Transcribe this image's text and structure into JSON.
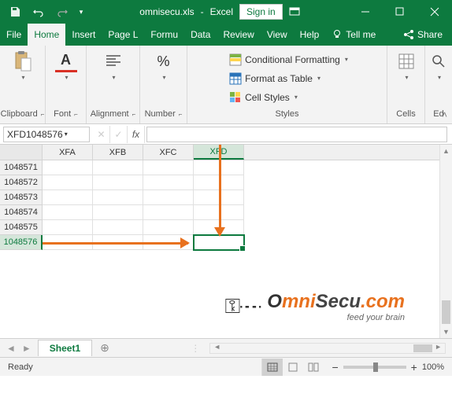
{
  "titlebar": {
    "filename": "omnisecu.xls",
    "app": "Excel",
    "signin": "Sign in"
  },
  "menu": {
    "file": "File",
    "home": "Home",
    "insert": "Insert",
    "pagelayout": "Page L",
    "formulas": "Formu",
    "data": "Data",
    "review": "Review",
    "view": "View",
    "help": "Help",
    "tellme": "Tell me",
    "share": "Share"
  },
  "ribbon": {
    "clipboard": "Clipboard",
    "font": "Font",
    "alignment": "Alignment",
    "number": "Number",
    "styles": "Styles",
    "cells": "Cells",
    "editing": "Ed",
    "cond_fmt": "Conditional Formatting",
    "fmt_table": "Format as Table",
    "cell_styles": "Cell Styles"
  },
  "formula": {
    "name_box": "XFD1048576",
    "fx": "fx"
  },
  "grid": {
    "cols": [
      "XFA",
      "XFB",
      "XFC",
      "XFD"
    ],
    "rows": [
      "1048571",
      "1048572",
      "1048573",
      "1048574",
      "1048575",
      "1048576"
    ],
    "selected_col": 3,
    "selected_row": 5
  },
  "sheets": {
    "active": "Sheet1"
  },
  "status": {
    "ready": "Ready",
    "zoom": "100%"
  },
  "watermark": {
    "text1": "O",
    "text2": "mni",
    "text3": "Secu",
    "text4": ".com",
    "sub": "feed your brain"
  }
}
